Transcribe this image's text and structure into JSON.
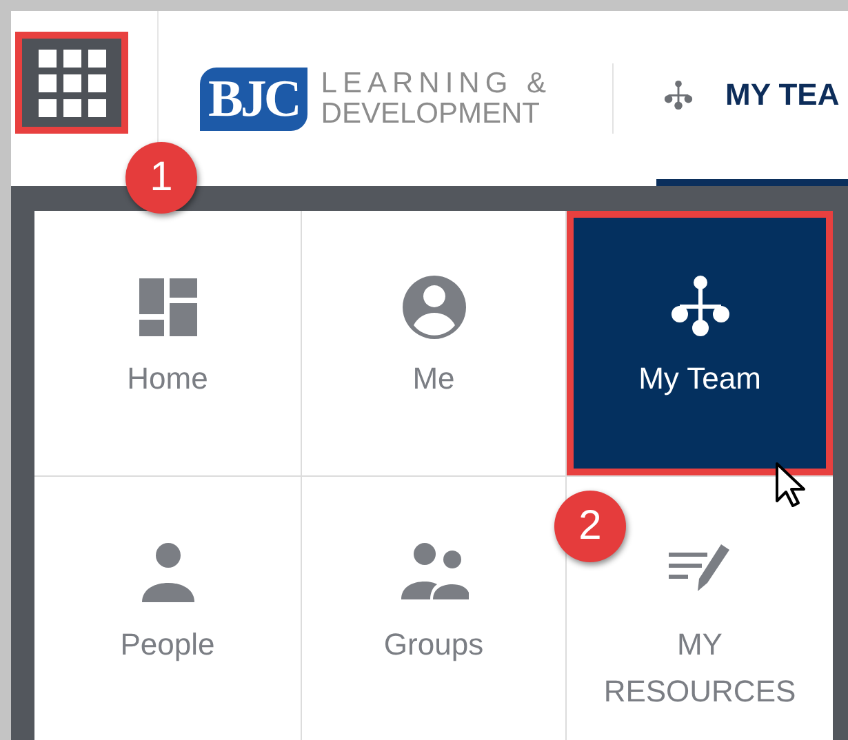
{
  "header": {
    "app_launcher": {
      "highlighted": true,
      "callout": "1"
    },
    "logo": {
      "mark": "BJC",
      "line_1": "LEARNING &",
      "line_2": "DEVELOPMENT"
    },
    "nav_tab": {
      "label": "MY TEA",
      "selected": true
    }
  },
  "tiles": [
    {
      "label": "Home",
      "kind": "home",
      "selected": false,
      "highlighted": false,
      "pointer": false
    },
    {
      "label": "Me",
      "kind": "me",
      "selected": false,
      "highlighted": false,
      "pointer": false
    },
    {
      "label": "My Team",
      "kind": "team",
      "selected": true,
      "highlighted": true,
      "pointer": true,
      "callout": "2"
    },
    {
      "label": "People",
      "kind": "people",
      "selected": false,
      "highlighted": false,
      "pointer": false
    },
    {
      "label": "Groups",
      "kind": "groups",
      "selected": false,
      "highlighted": false,
      "pointer": false
    },
    {
      "label": "MY\nRESOURCES",
      "kind": "resources",
      "selected": false,
      "highlighted": false,
      "pointer": false
    }
  ]
}
